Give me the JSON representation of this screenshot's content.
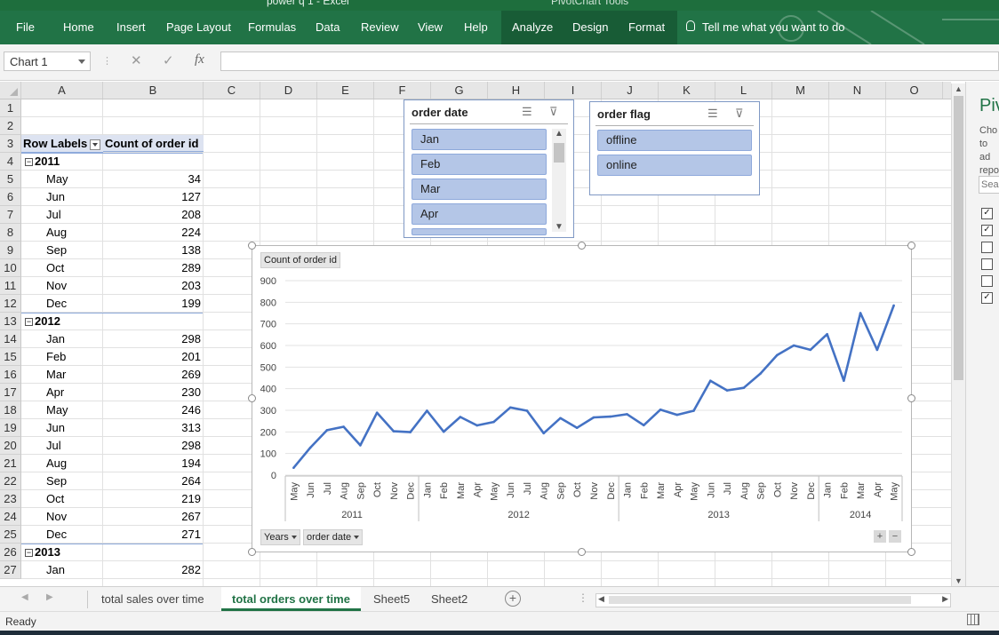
{
  "window": {
    "title": "power q 1 - Excel",
    "context_tab_group": "PivotChart Tools"
  },
  "ribbon": {
    "tabs": [
      "File",
      "Home",
      "Insert",
      "Page Layout",
      "Formulas",
      "Data",
      "Review",
      "View",
      "Help",
      "Analyze",
      "Design",
      "Format"
    ],
    "active_context_tabs": [
      "Analyze",
      "Design",
      "Format"
    ],
    "tell_me": "Tell me what you want to do",
    "accent_color": "#217346"
  },
  "formula_bar": {
    "name_box": "Chart 1",
    "cancel_icon": "✕",
    "enter_icon": "✓",
    "fx_icon": "fx",
    "formula": ""
  },
  "columns": [
    "A",
    "B",
    "C",
    "D",
    "E",
    "F",
    "G",
    "H",
    "I",
    "J",
    "K",
    "L",
    "M",
    "N",
    "O"
  ],
  "rows": [
    "1",
    "2",
    "3",
    "4",
    "5",
    "6",
    "7",
    "8",
    "9",
    "10",
    "11",
    "12",
    "13",
    "14",
    "15",
    "16",
    "17",
    "18",
    "19",
    "20",
    "21",
    "22",
    "23",
    "24",
    "25",
    "26",
    "27"
  ],
  "pivot": {
    "row_labels_header": "Row Labels",
    "value_header": "Count of order id",
    "collapse_symbol": "−",
    "rows": [
      {
        "type": "year",
        "label": "2011",
        "value": ""
      },
      {
        "type": "month",
        "label": "May",
        "value": "34"
      },
      {
        "type": "month",
        "label": "Jun",
        "value": "127"
      },
      {
        "type": "month",
        "label": "Jul",
        "value": "208"
      },
      {
        "type": "month",
        "label": "Aug",
        "value": "224"
      },
      {
        "type": "month",
        "label": "Sep",
        "value": "138"
      },
      {
        "type": "month",
        "label": "Oct",
        "value": "289"
      },
      {
        "type": "month",
        "label": "Nov",
        "value": "203"
      },
      {
        "type": "month",
        "label": "Dec",
        "value": "199"
      },
      {
        "type": "year",
        "label": "2012",
        "value": ""
      },
      {
        "type": "month",
        "label": "Jan",
        "value": "298"
      },
      {
        "type": "month",
        "label": "Feb",
        "value": "201"
      },
      {
        "type": "month",
        "label": "Mar",
        "value": "269"
      },
      {
        "type": "month",
        "label": "Apr",
        "value": "230"
      },
      {
        "type": "month",
        "label": "May",
        "value": "246"
      },
      {
        "type": "month",
        "label": "Jun",
        "value": "313"
      },
      {
        "type": "month",
        "label": "Jul",
        "value": "298"
      },
      {
        "type": "month",
        "label": "Aug",
        "value": "194"
      },
      {
        "type": "month",
        "label": "Sep",
        "value": "264"
      },
      {
        "type": "month",
        "label": "Oct",
        "value": "219"
      },
      {
        "type": "month",
        "label": "Nov",
        "value": "267"
      },
      {
        "type": "month",
        "label": "Dec",
        "value": "271"
      },
      {
        "type": "year",
        "label": "2013",
        "value": ""
      },
      {
        "type": "month",
        "label": "Jan",
        "value": "282"
      }
    ]
  },
  "slicers": {
    "order_date": {
      "title": "order date",
      "items": [
        "Jan",
        "Feb",
        "Mar",
        "Apr"
      ]
    },
    "order_flag": {
      "title": "order flag",
      "items": [
        "offline",
        "online"
      ]
    },
    "item_color": "#b4c6e7"
  },
  "chart_data": {
    "type": "line",
    "title": "",
    "value_field_button": "Count of order id",
    "axis_field_buttons": [
      "Years",
      "order date"
    ],
    "ylim": [
      0,
      900
    ],
    "yticks": [
      0,
      100,
      200,
      300,
      400,
      500,
      600,
      700,
      800,
      900
    ],
    "grid": true,
    "legend": "none",
    "line_color": "#4472c4",
    "groups": [
      {
        "label": "2011",
        "months": [
          "May",
          "Jun",
          "Jul",
          "Aug",
          "Sep",
          "Oct",
          "Nov",
          "Dec"
        ]
      },
      {
        "label": "2012",
        "months": [
          "Jan",
          "Feb",
          "Mar",
          "Apr",
          "May",
          "Jun",
          "Jul",
          "Aug",
          "Sep",
          "Oct",
          "Nov",
          "Dec"
        ]
      },
      {
        "label": "2013",
        "months": [
          "Jan",
          "Feb",
          "Mar",
          "Apr",
          "May",
          "Jun",
          "Jul",
          "Aug",
          "Sep",
          "Oct",
          "Nov",
          "Dec"
        ]
      },
      {
        "label": "2014",
        "months": [
          "Jan",
          "Feb",
          "Mar",
          "Apr",
          "May"
        ]
      }
    ],
    "series": [
      {
        "values": [
          34,
          127,
          208,
          224,
          138,
          289,
          203,
          199,
          298,
          201,
          269,
          230,
          246,
          313,
          298,
          194,
          264,
          219,
          267,
          271,
          282,
          231,
          303,
          279,
          298,
          437,
          392,
          404,
          470,
          555,
          600,
          580,
          652,
          437,
          750,
          580,
          785
        ]
      }
    ]
  },
  "pivot_pane": {
    "title": "Piv",
    "desc_lines": [
      "Cho",
      "to ad",
      "repo"
    ],
    "search_placeholder": "Sear",
    "fields": [
      {
        "checked": true
      },
      {
        "checked": true
      },
      {
        "checked": false
      },
      {
        "checked": false
      },
      {
        "checked": false
      },
      {
        "checked": true
      }
    ]
  },
  "sheet_tabs": {
    "tabs": [
      "total sales over time",
      "total orders over time",
      "Sheet5",
      "Sheet2"
    ],
    "active": "total orders over time",
    "add_symbol": "+"
  },
  "status": {
    "text": "Ready"
  }
}
